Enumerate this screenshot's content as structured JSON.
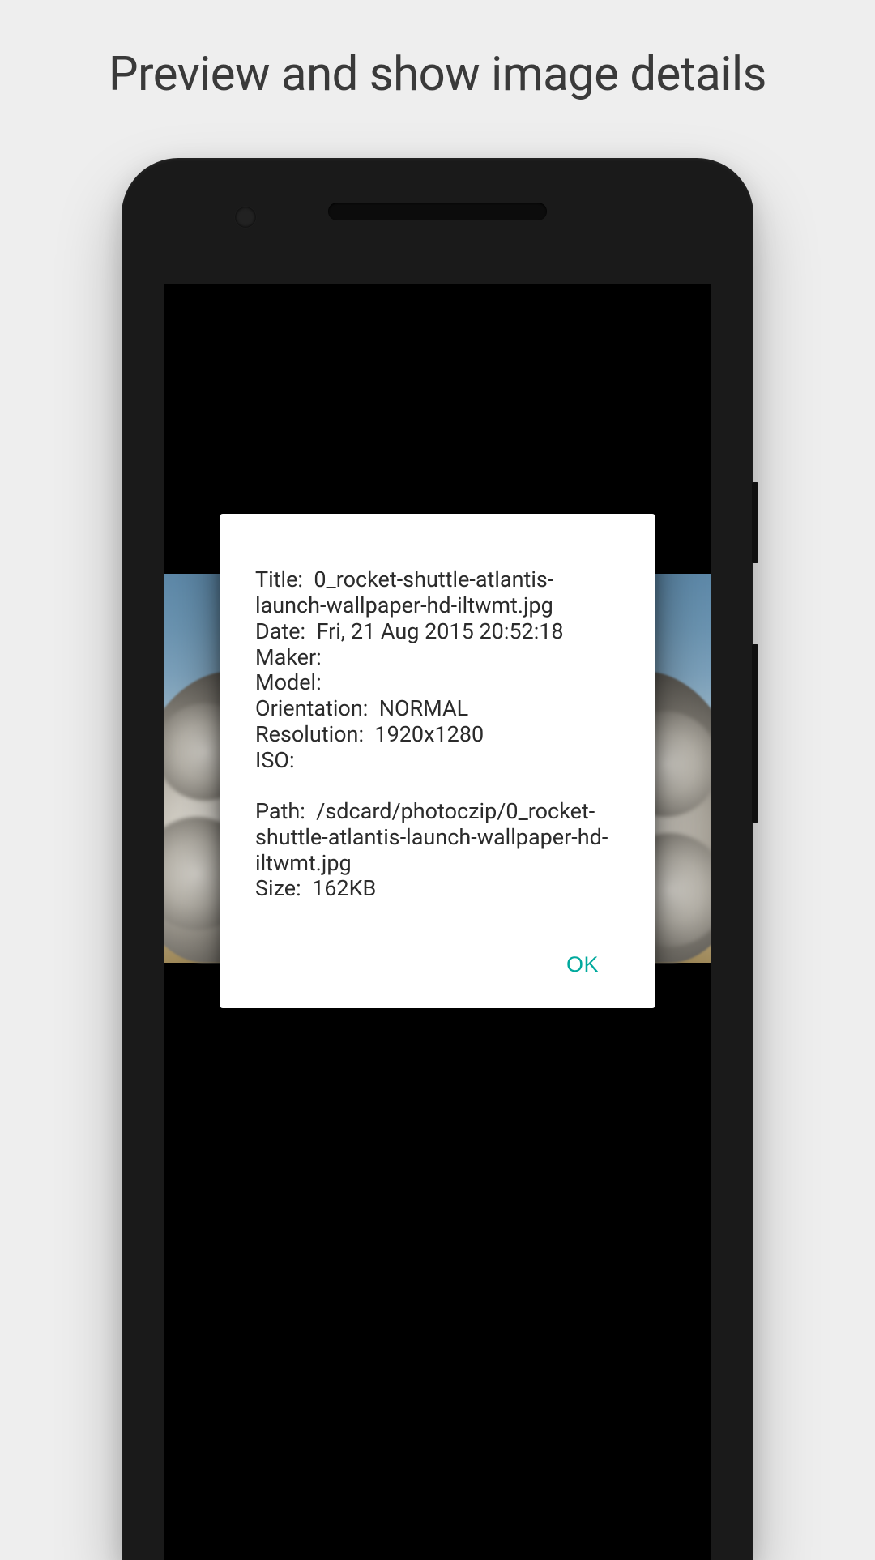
{
  "page": {
    "title": "Preview and show image details"
  },
  "dialog": {
    "labels": {
      "title": "Title:",
      "date": "Date:",
      "maker": "Maker:",
      "model": "Model:",
      "orientation": "Orientation:",
      "resolution": "Resolution:",
      "iso": "ISO:",
      "path": "Path:",
      "size": "Size:"
    },
    "values": {
      "title": "0_rocket-shuttle-atlantis-launch-wallpaper-hd-iltwmt.jpg",
      "date": "Fri, 21 Aug 2015 20:52:18",
      "maker": "",
      "model": "",
      "orientation": "NORMAL",
      "resolution": "1920x1280",
      "iso": "",
      "path": "/sdcard/photoczip/0_rocket-shuttle-atlantis-launch-wallpaper-hd-iltwmt.jpg",
      "size": "162KB"
    },
    "ok_label": "OK"
  }
}
